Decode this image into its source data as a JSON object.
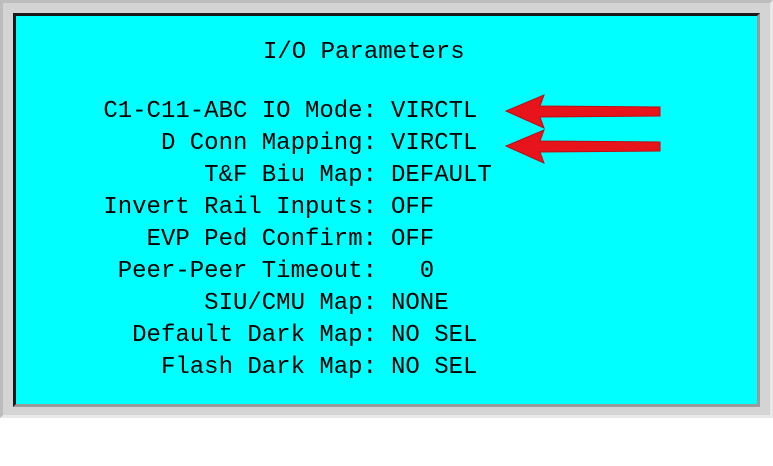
{
  "screen": {
    "title": "I/O Parameters",
    "params": [
      {
        "label": "C1-C11-ABC IO Mode:",
        "value": "VIRCTL"
      },
      {
        "label": "D Conn Mapping:",
        "value": "VIRCTL"
      },
      {
        "label": "T&F Biu Map:",
        "value": "DEFAULT"
      },
      {
        "label": "Invert Rail Inputs:",
        "value": "OFF"
      },
      {
        "label": "EVP Ped Confirm:",
        "value": "OFF"
      },
      {
        "label": "Peer-Peer Timeout:",
        "value": "  0"
      },
      {
        "label": "SIU/CMU Map:",
        "value": "NONE"
      },
      {
        "label": "Default Dark Map:",
        "value": "NO SEL"
      },
      {
        "label": "Flash Dark Map:",
        "value": "NO SEL"
      }
    ]
  },
  "colors": {
    "screen_background": "#00ffff",
    "text": "#000000",
    "annotation_arrow": "#e8141c"
  },
  "annotations": [
    {
      "icon": "arrow-left-icon",
      "points_to": "C1-C11-ABC IO Mode"
    },
    {
      "icon": "arrow-left-icon",
      "points_to": "D Conn Mapping"
    }
  ]
}
